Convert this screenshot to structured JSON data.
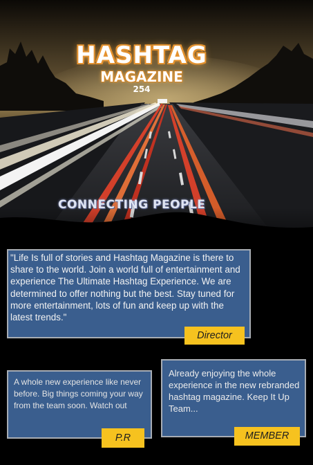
{
  "hero": {
    "brand_title": "HASHTAG",
    "brand_subtitle": "MAGAZINE",
    "brand_number": "254",
    "tagline": "CONNECTING PEOPLE"
  },
  "quotes": [
    {
      "text": " \"Life Is full of stories and Hashtag Magazine is there to share to the world. Join a world full of entertainment and experience The Ultimate Hashtag Experience. We are determined to offer nothing but the best. Stay tuned for more entertainment, lots of fun and keep up with the latest trends.\"",
      "role": "Director"
    },
    {
      "text": "A whole new experience like never before. Big things coming your way from the team soon. Watch out",
      "role": "P.R"
    },
    {
      "text": "Already enjoying the whole experience in the new rebranded hashtag magazine. Keep It Up Team...",
      "role": "MEMBER"
    }
  ],
  "colors": {
    "card_background": "#3a5e8e",
    "card_border": "#a8adb4",
    "role_tag": "#f6c21f",
    "brand_glow": "#e4922f",
    "page_background": "#000000"
  }
}
